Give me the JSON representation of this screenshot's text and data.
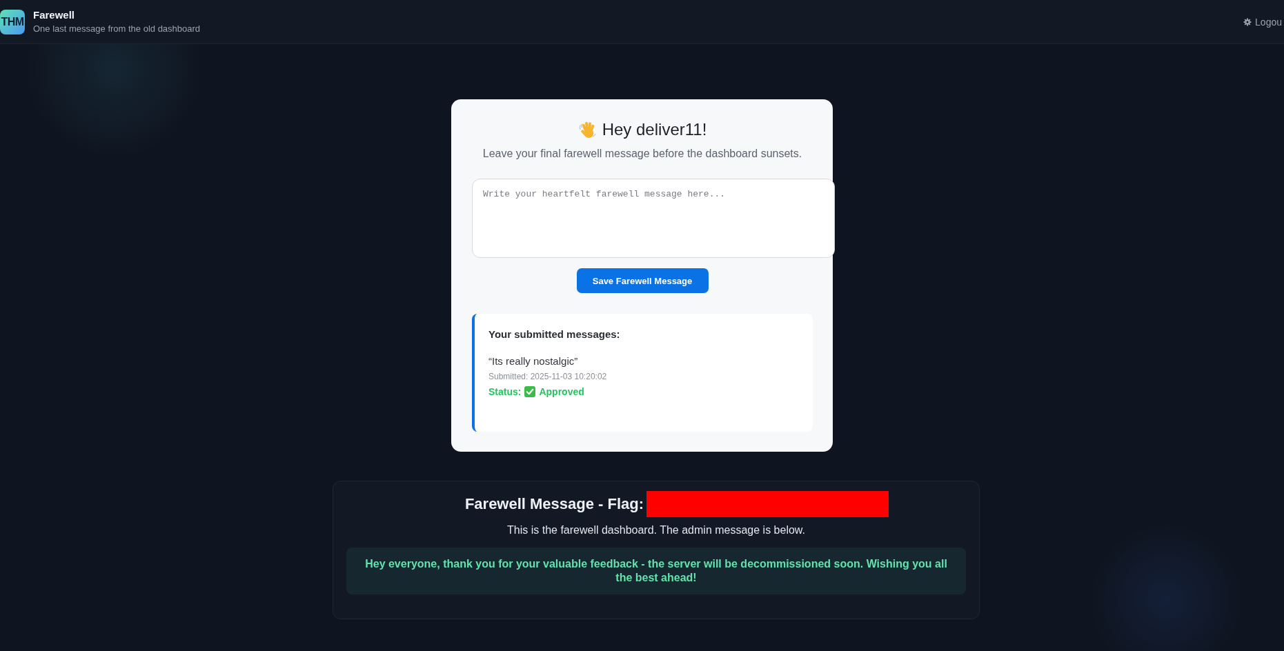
{
  "header": {
    "logo": "THM",
    "title": "Farewell",
    "subtitle": "One last message from the old dashboard",
    "logout": "Logou"
  },
  "card": {
    "greeting": "Hey deliver11!",
    "intro": "Leave your final farewell message before the dashboard sunsets.",
    "message_field": {
      "placeholder": "Write your heartfelt farewell message here..."
    },
    "save_button": "Save Farewell Message",
    "submitted": {
      "heading": "Your submitted messages:",
      "messages": [
        {
          "text": "“Its really nostalgic”",
          "submitted": "Submitted: 2025-11-03 10:20:02",
          "status_label": "Status:",
          "status": "Approved",
          "kind": "approved"
        }
      ]
    }
  },
  "flag_panel": {
    "title": "Farewell Message - Flag:",
    "redacted": true,
    "description": "This is the farewell dashboard. The admin message is below.",
    "admin_message": "Hey everyone, thank you for your valuable feedback - the server will be decommissioned soon. Wishing you all the best ahead!"
  }
}
